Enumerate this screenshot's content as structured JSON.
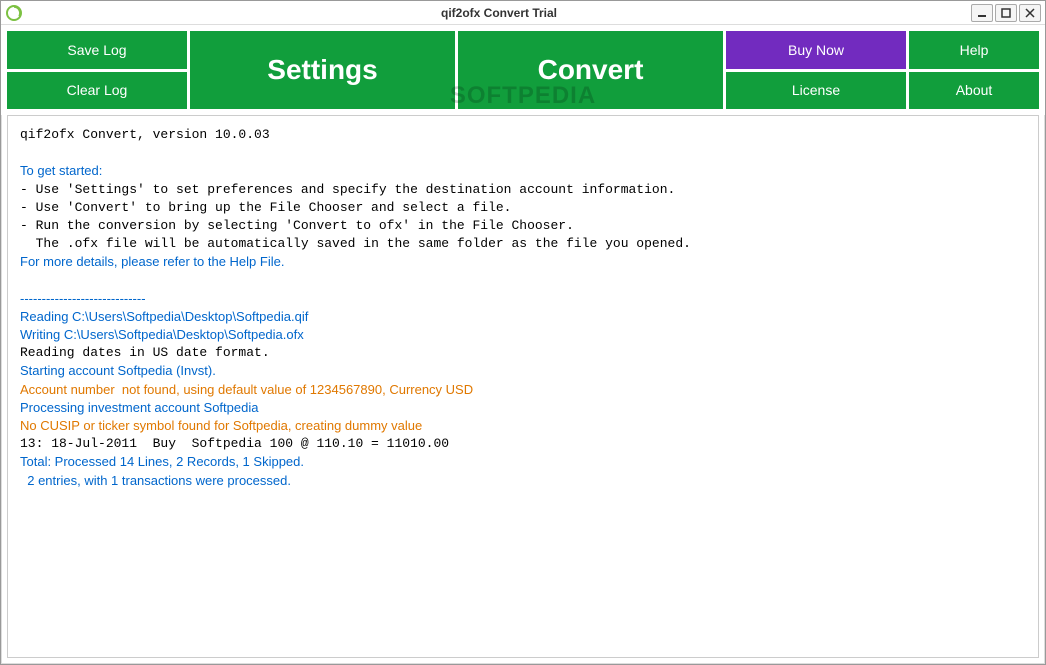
{
  "window": {
    "title": "qif2ofx Convert Trial"
  },
  "toolbar": {
    "save_log": "Save Log",
    "clear_log": "Clear Log",
    "settings": "Settings",
    "convert": "Convert",
    "buy_now": "Buy Now",
    "help": "Help",
    "license": "License",
    "about": "About"
  },
  "watermark": "SOFTPEDIA",
  "log": {
    "version_line": "qif2ofx Convert, version 10.0.03",
    "to_get_started": "To get started:",
    "line1": "- Use 'Settings' to set preferences and specify the destination account information.",
    "line2": "- Use 'Convert' to bring up the File Chooser and select a file.",
    "line3": "- Run the conversion by selecting 'Convert to ofx' in the File Chooser.",
    "line4": "  The .ofx file will be automatically saved in the same folder as the file you opened.",
    "help_ref": "For more details, please refer to the Help File.",
    "divider": "-----------------------------",
    "reading": "Reading C:\\Users\\Softpedia\\Desktop\\Softpedia.qif",
    "writing": "Writing C:\\Users\\Softpedia\\Desktop\\Softpedia.ofx",
    "dates": "Reading dates in US date format.",
    "starting": "Starting account Softpedia (Invst).",
    "account_not_found": "Account number  not found, using default value of 1234567890, Currency USD",
    "processing": "Processing investment account Softpedia",
    "no_cusip": "No CUSIP or ticker symbol found for Softpedia, creating dummy value",
    "transaction": "13: 18-Jul-2011  Buy  Softpedia 100 @ 110.10 = 11010.00",
    "total": "Total: Processed 14 Lines, 2 Records, 1 Skipped.",
    "entries": "  2 entries, with 1 transactions were processed."
  }
}
